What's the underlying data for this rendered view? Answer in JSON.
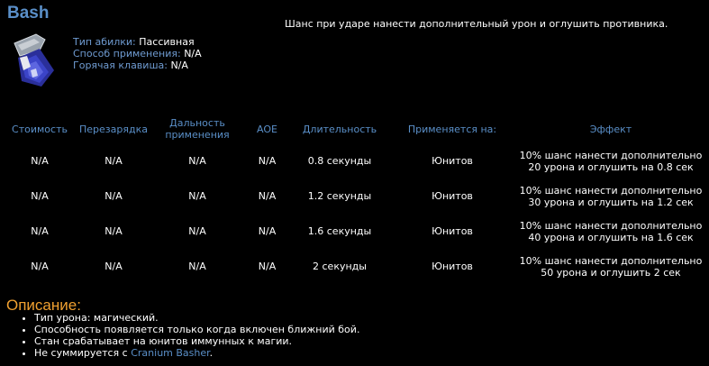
{
  "ability": {
    "name": "Bash",
    "icon": "bash-ability-icon",
    "summary": "Шанс при ударе нанести дополнительный урон и оглушить противника.",
    "meta": [
      {
        "key": "Тип абилки:",
        "value": "Пассивная"
      },
      {
        "key": "Способ применения:",
        "value": "N/A"
      },
      {
        "key": "Горячая клавиша:",
        "value": "N/A"
      }
    ]
  },
  "table": {
    "headers": {
      "cost": "Стоимость",
      "cooldown": "Перезарядка",
      "range_line1": "Дальность",
      "range_line2": "применения",
      "aoe": "AOE",
      "duration": "Длительность",
      "applies_to": "Применяется на:",
      "effect": "Эффект"
    },
    "rows": [
      {
        "cost": "N/A",
        "cooldown": "N/A",
        "range": "N/A",
        "aoe": "N/A",
        "duration": "0.8 секунды",
        "applies_to": "Юнитов",
        "effect_line1": "10% шанс нанести дополнительно",
        "effect_line2": "20 урона и оглушить на 0.8 сек"
      },
      {
        "cost": "N/A",
        "cooldown": "N/A",
        "range": "N/A",
        "aoe": "N/A",
        "duration": "1.2 секунды",
        "applies_to": "Юнитов",
        "effect_line1": "10% шанс нанести дополнительно",
        "effect_line2": "30 урона и оглушить на 1.2 сек"
      },
      {
        "cost": "N/A",
        "cooldown": "N/A",
        "range": "N/A",
        "aoe": "N/A",
        "duration": "1.6 секунды",
        "applies_to": "Юнитов",
        "effect_line1": "10% шанс нанести дополнительно",
        "effect_line2": "40 урона и оглушить на 1.6 сек"
      },
      {
        "cost": "N/A",
        "cooldown": "N/A",
        "range": "N/A",
        "aoe": "N/A",
        "duration": "2 секунды",
        "applies_to": "Юнитов",
        "effect_line1": "10% шанс нанести дополнительно",
        "effect_line2": "50 урона и оглушить 2 сек"
      }
    ]
  },
  "description": {
    "title": "Описание:",
    "notes": [
      "Тип урона: магический.",
      "Способность появляется только когда включен ближний бой.",
      "Стан срабатывает на юнитов иммунных к магии."
    ],
    "last_note_prefix": "Не суммируется с ",
    "last_note_link": "Cranium Basher",
    "last_note_suffix": "."
  },
  "colors": {
    "background": "#000000",
    "heading_blue": "#5a8fc8",
    "label_blue": "#6f9bd1",
    "desc_orange": "#f0a030"
  }
}
